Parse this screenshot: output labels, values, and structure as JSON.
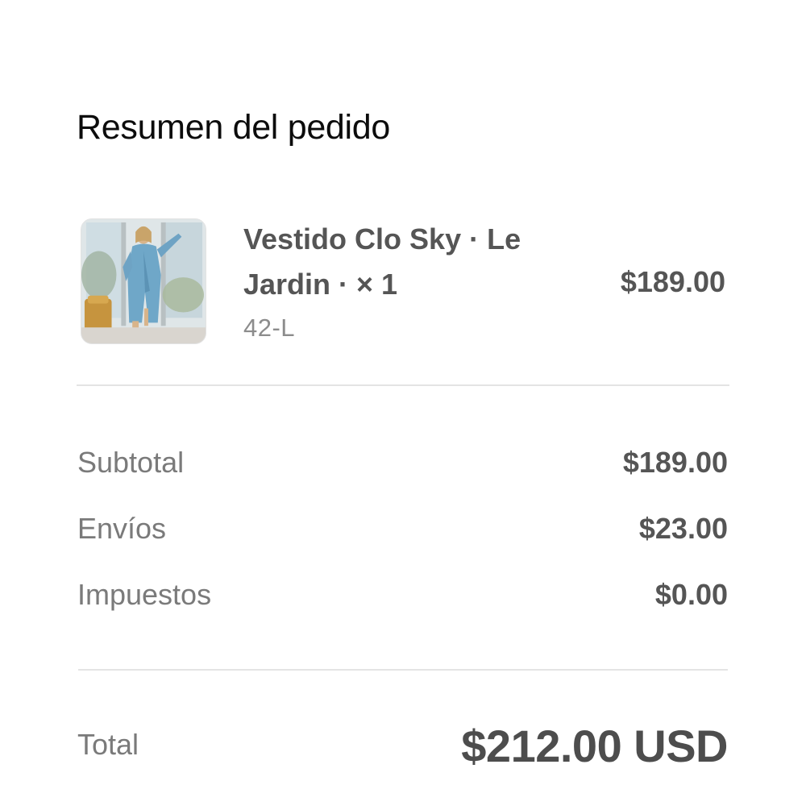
{
  "summary": {
    "title": "Resumen del pedido"
  },
  "item": {
    "name": "Vestido Clo Sky · Le Jardin · × 1",
    "variant": "42-L",
    "price": "$189.00",
    "thumbnail_icon": "product-photo-blue-dress"
  },
  "costs": {
    "subtotal_label": "Subtotal",
    "subtotal_value": "$189.00",
    "shipping_label": "Envíos",
    "shipping_value": "$23.00",
    "taxes_label": "Impuestos",
    "taxes_value": "$0.00"
  },
  "total": {
    "label": "Total",
    "value": "$212.00 USD"
  }
}
